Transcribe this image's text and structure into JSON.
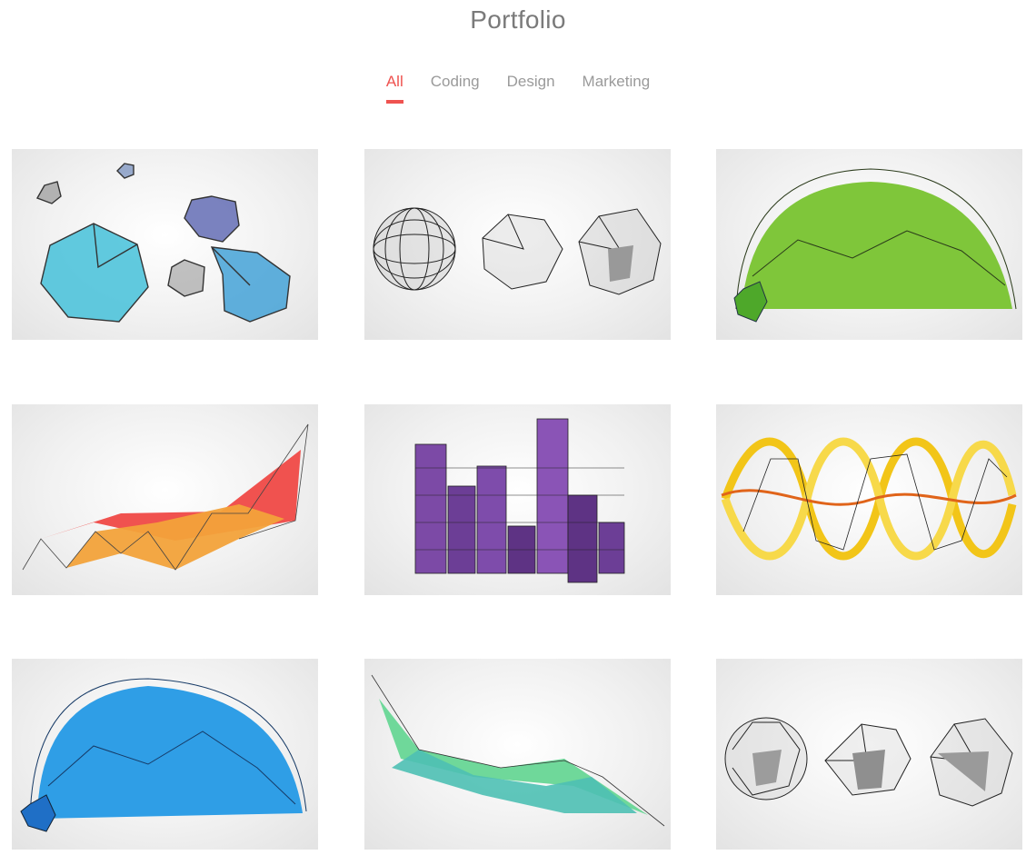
{
  "page": {
    "title": "Portfolio"
  },
  "tabs": [
    {
      "label": "All",
      "active": true
    },
    {
      "label": "Coding",
      "active": false
    },
    {
      "label": "Design",
      "active": false
    },
    {
      "label": "Marketing",
      "active": false
    }
  ],
  "colors": {
    "accent": "#ef5350",
    "tab_inactive": "#9a9a9a",
    "title": "#7a7a7a"
  },
  "portfolio_items": [
    {
      "art": "blue-icosahedra"
    },
    {
      "art": "wireframe-spheres"
    },
    {
      "art": "green-dome"
    },
    {
      "art": "red-orange-ribbon"
    },
    {
      "art": "purple-bars"
    },
    {
      "art": "yellow-helix"
    },
    {
      "art": "blue-dome"
    },
    {
      "art": "green-teal-ribbon"
    },
    {
      "art": "gray-polyhedra"
    }
  ]
}
